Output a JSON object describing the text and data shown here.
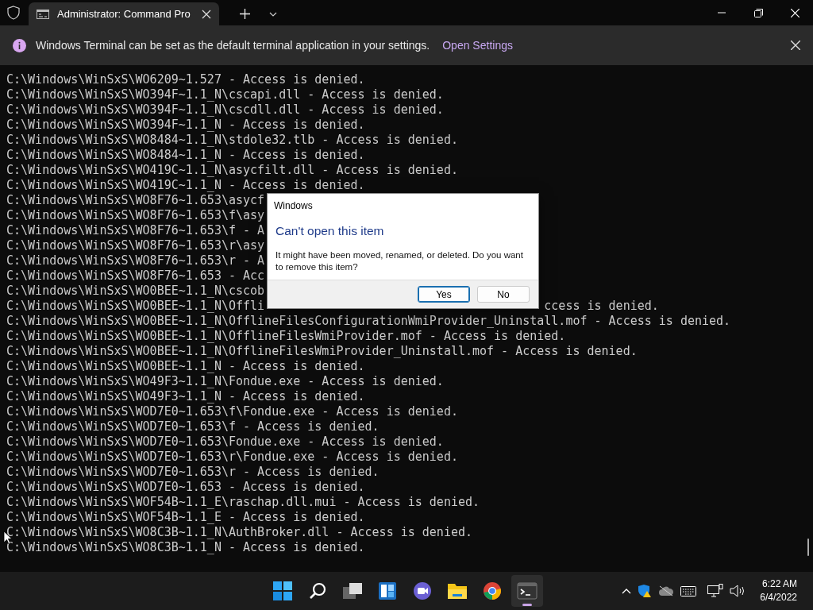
{
  "tabs": [
    {
      "title": "Administrator: Command Pro",
      "selected": true
    }
  ],
  "info_bar": {
    "message": "Windows Terminal can be set as the default terminal application in your settings.",
    "link": "Open Settings"
  },
  "terminal": {
    "lines": [
      {
        "left": "C:\\Windows\\WinSxS\\WO6209~1.527 - Access is denied."
      },
      {
        "left": "C:\\Windows\\WinSxS\\WO394F~1.1_N\\cscapi.dll - Access is denied."
      },
      {
        "left": "C:\\Windows\\WinSxS\\WO394F~1.1_N\\cscdll.dll - Access is denied."
      },
      {
        "left": "C:\\Windows\\WinSxS\\WO394F~1.1_N - Access is denied."
      },
      {
        "left": "C:\\Windows\\WinSxS\\WO8484~1.1_N\\stdole32.tlb - Access is denied."
      },
      {
        "left": "C:\\Windows\\WinSxS\\WO8484~1.1_N - Access is denied."
      },
      {
        "left": "C:\\Windows\\WinSxS\\WO419C~1.1_N\\asycfilt.dll - Access is denied."
      },
      {
        "left": "C:\\Windows\\WinSxS\\WO419C~1.1_N - Access is denied."
      },
      {
        "left": "C:\\Windows\\WinSxS\\WO8F76~1.653\\asycf"
      },
      {
        "left": "C:\\Windows\\WinSxS\\WO8F76~1.653\\f\\asy"
      },
      {
        "left": "C:\\Windows\\WinSxS\\WO8F76~1.653\\f - A"
      },
      {
        "left": "C:\\Windows\\WinSxS\\WO8F76~1.653\\r\\asy"
      },
      {
        "left": "C:\\Windows\\WinSxS\\WO8F76~1.653\\r - A"
      },
      {
        "left": "C:\\Windows\\WinSxS\\WO8F76~1.653 - Acc"
      },
      {
        "left": "C:\\Windows\\WinSxS\\WO0BEE~1.1_N\\cscob"
      },
      {
        "left": "C:\\Windows\\WinSxS\\WO0BEE~1.1_N\\Offli",
        "right": "ccess is denied."
      },
      {
        "left": "C:\\Windows\\WinSxS\\WO0BEE~1.1_N\\OfflineFilesConfigurationWmiProvider_Uninstall.mof - Access is denied."
      },
      {
        "left": "C:\\Windows\\WinSxS\\WO0BEE~1.1_N\\OfflineFilesWmiProvider.mof - Access is denied."
      },
      {
        "left": "C:\\Windows\\WinSxS\\WO0BEE~1.1_N\\OfflineFilesWmiProvider_Uninstall.mof - Access is denied."
      },
      {
        "left": "C:\\Windows\\WinSxS\\WO0BEE~1.1_N - Access is denied."
      },
      {
        "left": "C:\\Windows\\WinSxS\\WO49F3~1.1_N\\Fondue.exe - Access is denied."
      },
      {
        "left": "C:\\Windows\\WinSxS\\WO49F3~1.1_N - Access is denied."
      },
      {
        "left": "C:\\Windows\\WinSxS\\WOD7E0~1.653\\f\\Fondue.exe - Access is denied."
      },
      {
        "left": "C:\\Windows\\WinSxS\\WOD7E0~1.653\\f - Access is denied."
      },
      {
        "left": "C:\\Windows\\WinSxS\\WOD7E0~1.653\\Fondue.exe - Access is denied."
      },
      {
        "left": "C:\\Windows\\WinSxS\\WOD7E0~1.653\\r\\Fondue.exe - Access is denied."
      },
      {
        "left": "C:\\Windows\\WinSxS\\WOD7E0~1.653\\r - Access is denied."
      },
      {
        "left": "C:\\Windows\\WinSxS\\WOD7E0~1.653 - Access is denied."
      },
      {
        "left": "C:\\Windows\\WinSxS\\WOF54B~1.1_E\\raschap.dll.mui - Access is denied."
      },
      {
        "left": "C:\\Windows\\WinSxS\\WOF54B~1.1_E - Access is denied."
      },
      {
        "left": "C:\\Windows\\WinSxS\\WO8C3B~1.1_N\\AuthBroker.dll - Access is denied."
      },
      {
        "left": "C:\\Windows\\WinSxS\\WO8C3B~1.1_N - Access is denied."
      }
    ]
  },
  "dialog": {
    "title": "Windows",
    "heading": "Can't open this item",
    "message": "It might have been moved, renamed, or deleted. Do you want to remove this item?",
    "buttons": [
      {
        "label": "Yes",
        "selected": true
      },
      {
        "label": "No",
        "selected": false
      }
    ]
  },
  "taskbar": {
    "apps": [
      {
        "kind": "start",
        "selected": false
      },
      {
        "kind": "search",
        "selected": false
      },
      {
        "kind": "taskview",
        "selected": false
      },
      {
        "kind": "widgets",
        "selected": false
      },
      {
        "kind": "chat",
        "selected": false
      },
      {
        "kind": "explorer",
        "selected": false
      },
      {
        "kind": "browser",
        "selected": false
      },
      {
        "kind": "terminal",
        "selected": true
      }
    ],
    "time": "6:22 AM",
    "date": "6/4/2022"
  }
}
